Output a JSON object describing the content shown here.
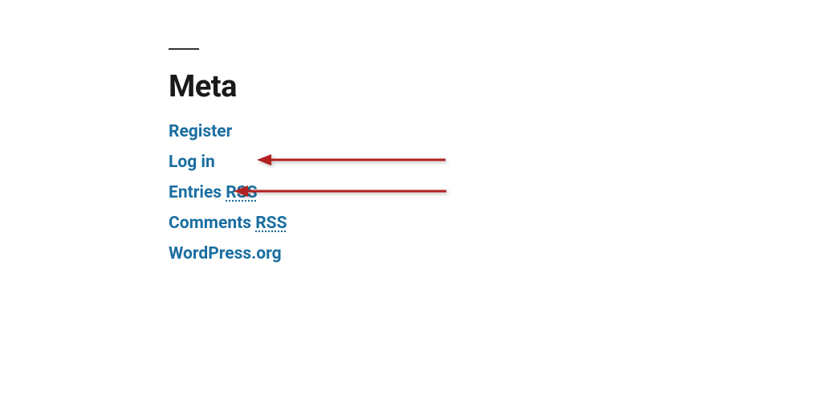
{
  "widget": {
    "title": "Meta",
    "links": {
      "register": "Register",
      "login": "Log in",
      "entries_prefix": "Entries ",
      "entries_rss": "RSS",
      "comments_prefix": "Comments ",
      "comments_rss": "RSS",
      "wordpress": "WordPress.org"
    }
  }
}
